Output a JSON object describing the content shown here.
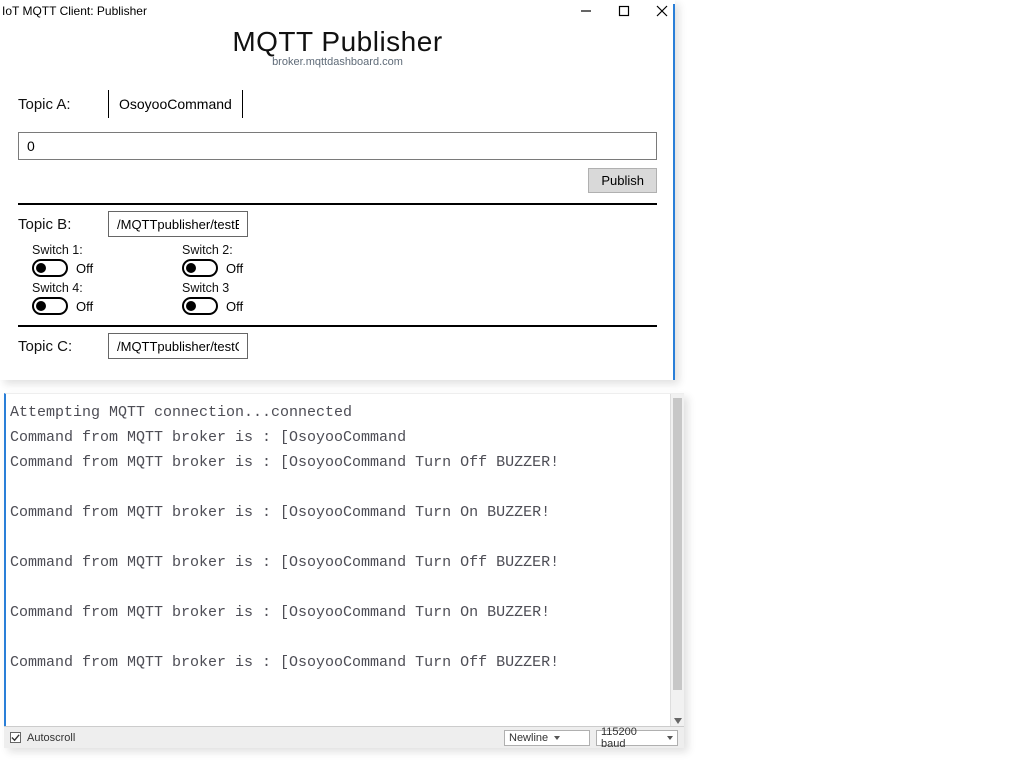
{
  "window": {
    "title": "IoT MQTT Client: Publisher"
  },
  "header": {
    "title": "MQTT Publisher",
    "broker": "broker.mqttdashboard.com"
  },
  "topicA": {
    "label": "Topic A:",
    "value": "OsoyooCommand",
    "message": "0",
    "publish_label": "Publish"
  },
  "topicB": {
    "label": "Topic B:",
    "value": "/MQTTpublisher/testB",
    "switches": [
      {
        "label": "Switch 1:",
        "state": "Off"
      },
      {
        "label": "Switch 2:",
        "state": "Off"
      },
      {
        "label": "Switch 4:",
        "state": "Off"
      },
      {
        "label": "Switch 3",
        "state": "Off"
      }
    ]
  },
  "topicC": {
    "label": "Topic C:",
    "value": "/MQTTpublisher/testC"
  },
  "serial": {
    "lines": [
      "Attempting MQTT connection...connected",
      "Command from MQTT broker is : [OsoyooCommand",
      "Command from MQTT broker is : [OsoyooCommand Turn Off BUZZER!",
      "",
      "Command from MQTT broker is : [OsoyooCommand Turn On BUZZER!",
      "",
      "Command from MQTT broker is : [OsoyooCommand Turn Off BUZZER!",
      "",
      "Command from MQTT broker is : [OsoyooCommand Turn On BUZZER!",
      "",
      "Command from MQTT broker is : [OsoyooCommand Turn Off BUZZER!"
    ],
    "footer": {
      "autoscroll": "Autoscroll",
      "line_ending": "Newline",
      "baud": "115200 baud"
    }
  }
}
